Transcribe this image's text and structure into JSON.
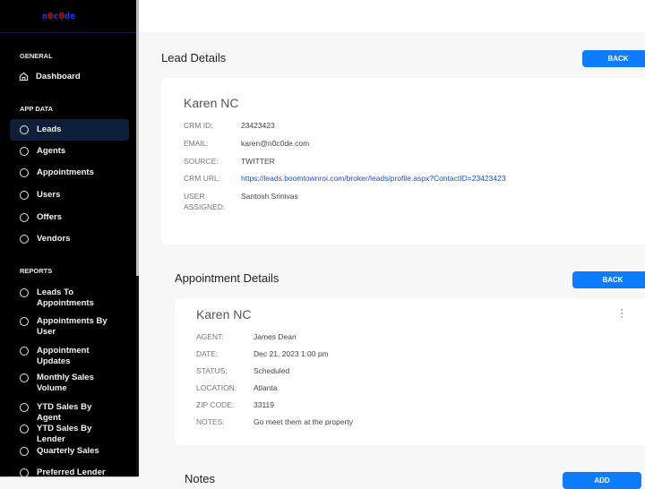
{
  "logo": {
    "parts": [
      {
        "t": "n",
        "c": "b"
      },
      {
        "t": "0",
        "c": "r"
      },
      {
        "t": "c",
        "c": "b"
      },
      {
        "t": "0",
        "c": "r"
      },
      {
        "t": "de",
        "c": "b"
      }
    ]
  },
  "sidebar": {
    "sections": {
      "general": "GENERAL",
      "app_data": "APP DATA",
      "reports": "REPORTS"
    },
    "dashboard": "Dashboard",
    "app_items": [
      "Leads",
      "Agents",
      "Appointments",
      "Users",
      "Offers",
      "Vendors"
    ],
    "report_items": [
      "Leads To Appointments",
      "Appointments By User",
      "Appointment Updates",
      "Monthly Sales Volume",
      "YTD Sales By Agent",
      "YTD Sales By Lender",
      "Quarterly Sales",
      "Preferred Lender"
    ],
    "active": "Leads"
  },
  "lead": {
    "heading": "Lead Details",
    "back": "BACK",
    "name": "Karen NC",
    "fields": [
      {
        "label": "CRM ID:",
        "value": "23423423"
      },
      {
        "label": "EMAIL:",
        "value": "karen@n0c0de.com"
      },
      {
        "label": "SOURCE:",
        "value": "TWITTER"
      },
      {
        "label": "CRM URL:",
        "value": "https://leads.boomtownroi.com/broker/leads/profile.aspx?ContactID=23423423"
      },
      {
        "label": "USER ASSIGNED:",
        "value": "Santosh Srinivas"
      }
    ]
  },
  "appointment": {
    "heading": "Appointment Details",
    "back": "BACK",
    "name": "Karen NC",
    "fields": [
      {
        "label": "AGENT:",
        "value": "James Dean"
      },
      {
        "label": "DATE:",
        "value": "Dec 21, 2023 1:00 pm"
      },
      {
        "label": "STATUS:",
        "value": "Scheduled"
      },
      {
        "label": "LOCATION:",
        "value": "Atlanta"
      },
      {
        "label": "ZIP CODE:",
        "value": "33119"
      },
      {
        "label": "NOTES:",
        "value": "Go meet them at the property"
      }
    ]
  },
  "notes": {
    "heading": "Notes",
    "add": "ADD"
  },
  "colors": {
    "accent": "#0d7cff",
    "sidebar_bg": "#000000",
    "active_bg": "#0e1f3a",
    "link": "#1a4fd6"
  }
}
